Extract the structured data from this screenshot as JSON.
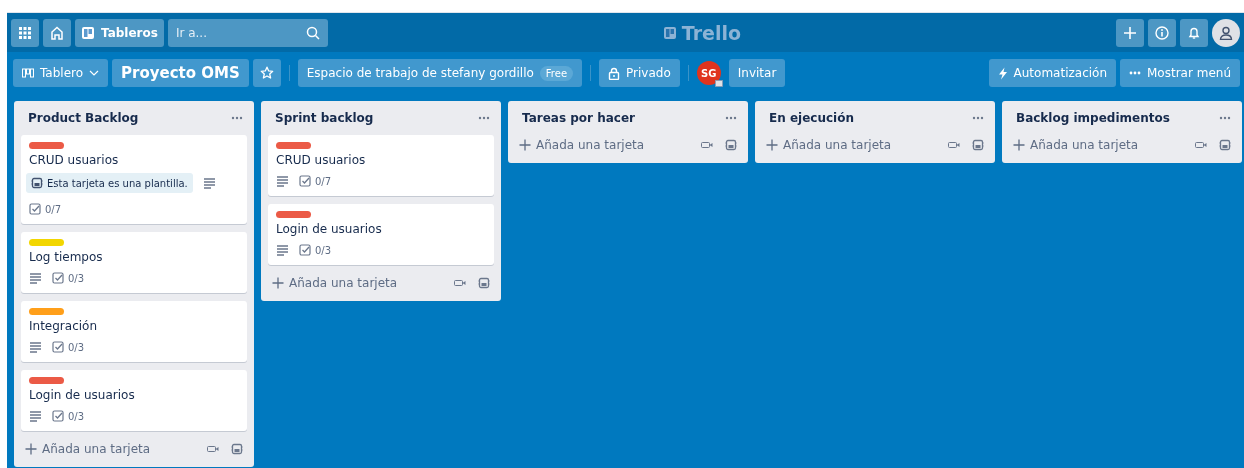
{
  "top_bar": {
    "boards_label": "Tableros",
    "search": {
      "placeholder": "Ir a..."
    },
    "logo": "Trello"
  },
  "board_header": {
    "view": "Tablero",
    "board_name": "Proyecto OMS",
    "starred": false,
    "workspace": "Espacio de trabajo de stefany gordillo",
    "workspace_badge": "Free",
    "visibility": "Privado",
    "member_initials": "SG",
    "invite": "Invitar",
    "automation": "Automatización",
    "menu": "Mostrar menú"
  },
  "lists": [
    {
      "title": "Product Backlog",
      "cards": [
        {
          "color": "#eb5a46",
          "title": "CRUD usuarios",
          "template_note": "Esta tarjeta es una plantilla.",
          "description": true,
          "checklist": "0/7"
        },
        {
          "color": "#f2d600",
          "title": "Log tiempos",
          "description": true,
          "checklist": "0/3"
        },
        {
          "color": "#ff9f1a",
          "title": "Integración",
          "description": true,
          "checklist": "0/3"
        },
        {
          "color": "#eb5a46",
          "title": "Login de usuarios",
          "description": true,
          "checklist": "0/3"
        }
      ],
      "add_card": "Añada una tarjeta"
    },
    {
      "title": "Sprint backlog",
      "cards": [
        {
          "color": "#eb5a46",
          "title": "CRUD usuarios",
          "description": true,
          "checklist": "0/7"
        },
        {
          "color": "#eb5a46",
          "title": "Login de usuarios",
          "description": true,
          "checklist": "0/3"
        }
      ],
      "add_card": "Añada una tarjeta"
    },
    {
      "title": "Tareas por hacer",
      "add_card": "Añada una tarjeta"
    },
    {
      "title": "En ejecución",
      "add_card": "Añada una tarjeta"
    },
    {
      "title": "Backlog impedimentos",
      "add_card": "Añada una tarjeta"
    }
  ]
}
